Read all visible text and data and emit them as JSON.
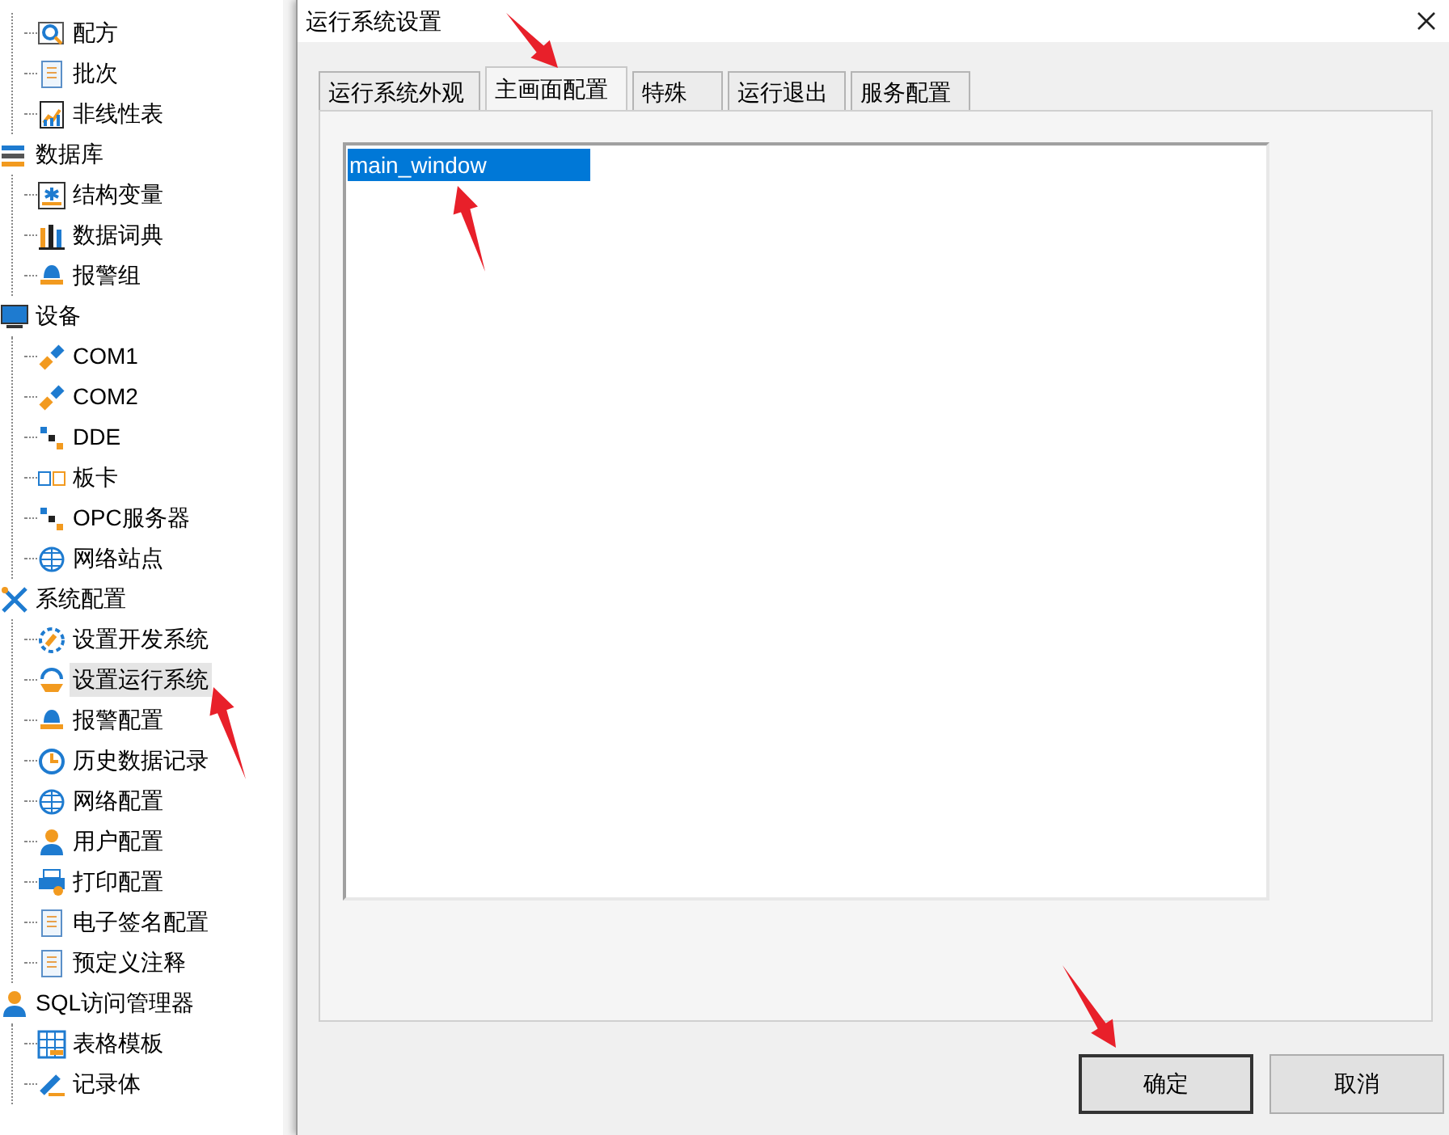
{
  "tree": {
    "continued_items": [
      {
        "label": "配方",
        "selected": false
      },
      {
        "label": "批次",
        "selected": false
      },
      {
        "label": "非线性表",
        "selected": false
      }
    ],
    "nodes": [
      {
        "label": "数据库",
        "selected": false,
        "children": [
          {
            "label": "结构变量",
            "selected": false
          },
          {
            "label": "数据词典",
            "selected": false
          },
          {
            "label": "报警组",
            "selected": false
          }
        ]
      },
      {
        "label": "设备",
        "selected": false,
        "children": [
          {
            "label": "COM1",
            "selected": false
          },
          {
            "label": "COM2",
            "selected": false
          },
          {
            "label": "DDE",
            "selected": false
          },
          {
            "label": "板卡",
            "selected": false
          },
          {
            "label": "OPC服务器",
            "selected": false
          },
          {
            "label": "网络站点",
            "selected": false
          }
        ]
      },
      {
        "label": "系统配置",
        "selected": false,
        "children": [
          {
            "label": "设置开发系统",
            "selected": false
          },
          {
            "label": "设置运行系统",
            "selected": true
          },
          {
            "label": "报警配置",
            "selected": false
          },
          {
            "label": "历史数据记录",
            "selected": false
          },
          {
            "label": "网络配置",
            "selected": false
          },
          {
            "label": "用户配置",
            "selected": false
          },
          {
            "label": "打印配置",
            "selected": false
          },
          {
            "label": "电子签名配置",
            "selected": false
          },
          {
            "label": "预定义注释",
            "selected": false
          }
        ]
      },
      {
        "label": "SQL访问管理器",
        "selected": false,
        "children": [
          {
            "label": "表格模板",
            "selected": false
          },
          {
            "label": "记录体",
            "selected": false
          }
        ]
      }
    ]
  },
  "dialog": {
    "title": "运行系统设置",
    "tabs": [
      {
        "label": "运行系统外观",
        "selected": false
      },
      {
        "label": "主画面配置",
        "selected": true
      },
      {
        "label": "特殊",
        "selected": false
      },
      {
        "label": "运行退出",
        "selected": false
      },
      {
        "label": "服务配置",
        "selected": false
      }
    ],
    "list": {
      "items": [
        {
          "text": "main_window",
          "selected": true
        }
      ]
    },
    "buttons": [
      {
        "label": "确定",
        "default": true
      },
      {
        "label": "取消",
        "default": false
      }
    ]
  }
}
